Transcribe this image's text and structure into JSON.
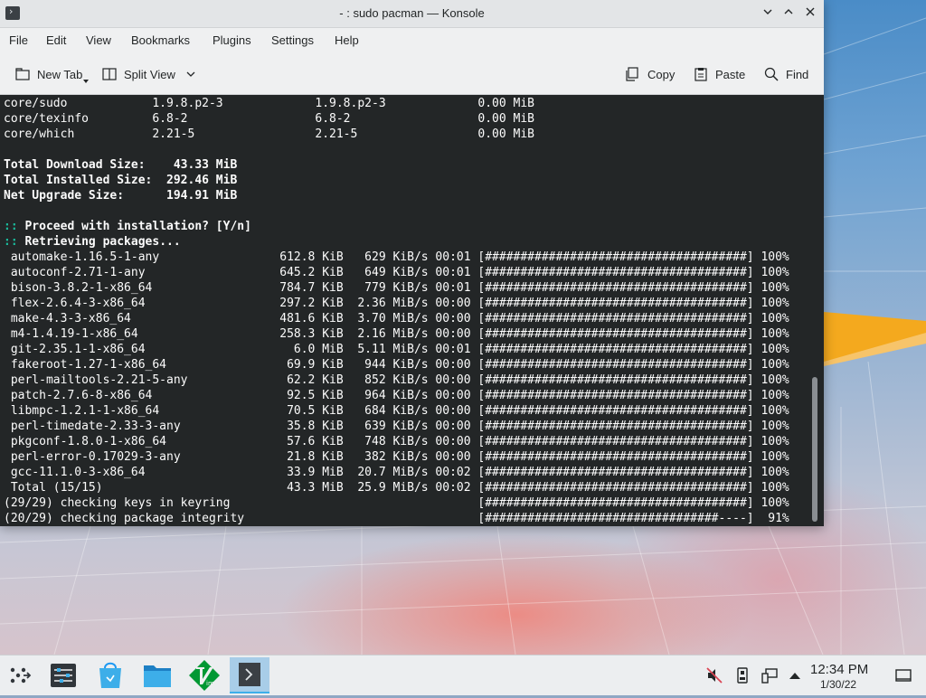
{
  "window": {
    "title": "- : sudo pacman — Konsole",
    "controls": [
      "minimize",
      "maximize",
      "close"
    ]
  },
  "menu": [
    "File",
    "Edit",
    "View",
    "Bookmarks",
    "Plugins",
    "Settings",
    "Help"
  ],
  "toolbar": {
    "new_tab": "New Tab",
    "split_view": "Split View",
    "copy": "Copy",
    "paste": "Paste",
    "find": "Find"
  },
  "terminal": {
    "lines": [
      {
        "text": "core/sudo            1.9.8.p2-3             1.9.8.p2-3             0.00 MiB",
        "bold": false
      },
      {
        "text": "core/texinfo         6.8-2                  6.8-2                  0.00 MiB",
        "bold": false
      },
      {
        "text": "core/which           2.21-5                 2.21-5                 0.00 MiB",
        "bold": false
      },
      {
        "text": "",
        "bold": false
      },
      {
        "text": "Total Download Size:    43.33 MiB",
        "bold": true
      },
      {
        "text": "Total Installed Size:  292.46 MiB",
        "bold": true
      },
      {
        "text": "Net Upgrade Size:      194.91 MiB",
        "bold": true
      },
      {
        "text": "",
        "bold": false
      },
      {
        "prefix": "::",
        "text": " Proceed with installation? [Y/n]",
        "bold": true
      },
      {
        "prefix": "::",
        "text": " Retrieving packages...",
        "bold": true
      },
      {
        "text": " automake-1.16.5-1-any                 612.8 KiB   629 KiB/s 00:01 [#####################################] 100%",
        "bold": false
      },
      {
        "text": " autoconf-2.71-1-any                   645.2 KiB   649 KiB/s 00:01 [#####################################] 100%",
        "bold": false
      },
      {
        "text": " bison-3.8.2-1-x86_64                  784.7 KiB   779 KiB/s 00:01 [#####################################] 100%",
        "bold": false
      },
      {
        "text": " flex-2.6.4-3-x86_64                   297.2 KiB  2.36 MiB/s 00:00 [#####################################] 100%",
        "bold": false
      },
      {
        "text": " make-4.3-3-x86_64                     481.6 KiB  3.70 MiB/s 00:00 [#####################################] 100%",
        "bold": false
      },
      {
        "text": " m4-1.4.19-1-x86_64                    258.3 KiB  2.16 MiB/s 00:00 [#####################################] 100%",
        "bold": false
      },
      {
        "text": " git-2.35.1-1-x86_64                     6.0 MiB  5.11 MiB/s 00:01 [#####################################] 100%",
        "bold": false
      },
      {
        "text": " fakeroot-1.27-1-x86_64                 69.9 KiB   944 KiB/s 00:00 [#####################################] 100%",
        "bold": false
      },
      {
        "text": " perl-mailtools-2.21-5-any              62.2 KiB   852 KiB/s 00:00 [#####################################] 100%",
        "bold": false
      },
      {
        "text": " patch-2.7.6-8-x86_64                   92.5 KiB   964 KiB/s 00:00 [#####################################] 100%",
        "bold": false
      },
      {
        "text": " libmpc-1.2.1-1-x86_64                  70.5 KiB   684 KiB/s 00:00 [#####################################] 100%",
        "bold": false
      },
      {
        "text": " perl-timedate-2.33-3-any               35.8 KiB   639 KiB/s 00:00 [#####################################] 100%",
        "bold": false
      },
      {
        "text": " pkgconf-1.8.0-1-x86_64                 57.6 KiB   748 KiB/s 00:00 [#####################################] 100%",
        "bold": false
      },
      {
        "text": " perl-error-0.17029-3-any               21.8 KiB   382 KiB/s 00:00 [#####################################] 100%",
        "bold": false
      },
      {
        "text": " gcc-11.1.0-3-x86_64                    33.9 MiB  20.7 MiB/s 00:02 [#####################################] 100%",
        "bold": false
      },
      {
        "text": " Total (15/15)                          43.3 MiB  25.9 MiB/s 00:02 [#####################################] 100%",
        "bold": false
      },
      {
        "text": "(29/29) checking keys in keyring                                   [#####################################] 100%",
        "bold": false
      },
      {
        "text": "(20/29) checking package integrity                                 [#################################----]  91%",
        "bold": false
      }
    ]
  },
  "taskbar": {
    "apps": [
      "application-launcher-icon",
      "system-settings-icon",
      "discover-store-icon",
      "file-manager-icon",
      "vim-icon",
      "konsole-icon"
    ],
    "tray": [
      "volume-muted-icon",
      "storage-icon",
      "network-icon",
      "expand-tray-icon"
    ],
    "time": "12:34 PM",
    "date": "1/30/22"
  },
  "colors": {
    "terminal_bg": "#232627",
    "terminal_fg": "#fcfcfc",
    "prompt_accent": "#1abc9c",
    "active_task": "#3daee9"
  }
}
